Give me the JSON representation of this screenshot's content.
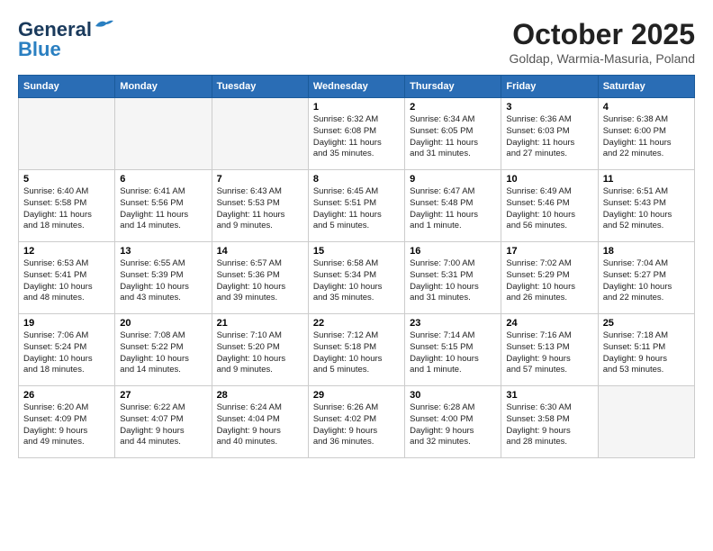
{
  "header": {
    "logo_line1": "General",
    "logo_line2": "Blue",
    "month": "October 2025",
    "location": "Goldap, Warmia-Masuria, Poland"
  },
  "weekdays": [
    "Sunday",
    "Monday",
    "Tuesday",
    "Wednesday",
    "Thursday",
    "Friday",
    "Saturday"
  ],
  "weeks": [
    [
      {
        "day": "",
        "info": ""
      },
      {
        "day": "",
        "info": ""
      },
      {
        "day": "",
        "info": ""
      },
      {
        "day": "1",
        "info": "Sunrise: 6:32 AM\nSunset: 6:08 PM\nDaylight: 11 hours\nand 35 minutes."
      },
      {
        "day": "2",
        "info": "Sunrise: 6:34 AM\nSunset: 6:05 PM\nDaylight: 11 hours\nand 31 minutes."
      },
      {
        "day": "3",
        "info": "Sunrise: 6:36 AM\nSunset: 6:03 PM\nDaylight: 11 hours\nand 27 minutes."
      },
      {
        "day": "4",
        "info": "Sunrise: 6:38 AM\nSunset: 6:00 PM\nDaylight: 11 hours\nand 22 minutes."
      }
    ],
    [
      {
        "day": "5",
        "info": "Sunrise: 6:40 AM\nSunset: 5:58 PM\nDaylight: 11 hours\nand 18 minutes."
      },
      {
        "day": "6",
        "info": "Sunrise: 6:41 AM\nSunset: 5:56 PM\nDaylight: 11 hours\nand 14 minutes."
      },
      {
        "day": "7",
        "info": "Sunrise: 6:43 AM\nSunset: 5:53 PM\nDaylight: 11 hours\nand 9 minutes."
      },
      {
        "day": "8",
        "info": "Sunrise: 6:45 AM\nSunset: 5:51 PM\nDaylight: 11 hours\nand 5 minutes."
      },
      {
        "day": "9",
        "info": "Sunrise: 6:47 AM\nSunset: 5:48 PM\nDaylight: 11 hours\nand 1 minute."
      },
      {
        "day": "10",
        "info": "Sunrise: 6:49 AM\nSunset: 5:46 PM\nDaylight: 10 hours\nand 56 minutes."
      },
      {
        "day": "11",
        "info": "Sunrise: 6:51 AM\nSunset: 5:43 PM\nDaylight: 10 hours\nand 52 minutes."
      }
    ],
    [
      {
        "day": "12",
        "info": "Sunrise: 6:53 AM\nSunset: 5:41 PM\nDaylight: 10 hours\nand 48 minutes."
      },
      {
        "day": "13",
        "info": "Sunrise: 6:55 AM\nSunset: 5:39 PM\nDaylight: 10 hours\nand 43 minutes."
      },
      {
        "day": "14",
        "info": "Sunrise: 6:57 AM\nSunset: 5:36 PM\nDaylight: 10 hours\nand 39 minutes."
      },
      {
        "day": "15",
        "info": "Sunrise: 6:58 AM\nSunset: 5:34 PM\nDaylight: 10 hours\nand 35 minutes."
      },
      {
        "day": "16",
        "info": "Sunrise: 7:00 AM\nSunset: 5:31 PM\nDaylight: 10 hours\nand 31 minutes."
      },
      {
        "day": "17",
        "info": "Sunrise: 7:02 AM\nSunset: 5:29 PM\nDaylight: 10 hours\nand 26 minutes."
      },
      {
        "day": "18",
        "info": "Sunrise: 7:04 AM\nSunset: 5:27 PM\nDaylight: 10 hours\nand 22 minutes."
      }
    ],
    [
      {
        "day": "19",
        "info": "Sunrise: 7:06 AM\nSunset: 5:24 PM\nDaylight: 10 hours\nand 18 minutes."
      },
      {
        "day": "20",
        "info": "Sunrise: 7:08 AM\nSunset: 5:22 PM\nDaylight: 10 hours\nand 14 minutes."
      },
      {
        "day": "21",
        "info": "Sunrise: 7:10 AM\nSunset: 5:20 PM\nDaylight: 10 hours\nand 9 minutes."
      },
      {
        "day": "22",
        "info": "Sunrise: 7:12 AM\nSunset: 5:18 PM\nDaylight: 10 hours\nand 5 minutes."
      },
      {
        "day": "23",
        "info": "Sunrise: 7:14 AM\nSunset: 5:15 PM\nDaylight: 10 hours\nand 1 minute."
      },
      {
        "day": "24",
        "info": "Sunrise: 7:16 AM\nSunset: 5:13 PM\nDaylight: 9 hours\nand 57 minutes."
      },
      {
        "day": "25",
        "info": "Sunrise: 7:18 AM\nSunset: 5:11 PM\nDaylight: 9 hours\nand 53 minutes."
      }
    ],
    [
      {
        "day": "26",
        "info": "Sunrise: 6:20 AM\nSunset: 4:09 PM\nDaylight: 9 hours\nand 49 minutes."
      },
      {
        "day": "27",
        "info": "Sunrise: 6:22 AM\nSunset: 4:07 PM\nDaylight: 9 hours\nand 44 minutes."
      },
      {
        "day": "28",
        "info": "Sunrise: 6:24 AM\nSunset: 4:04 PM\nDaylight: 9 hours\nand 40 minutes."
      },
      {
        "day": "29",
        "info": "Sunrise: 6:26 AM\nSunset: 4:02 PM\nDaylight: 9 hours\nand 36 minutes."
      },
      {
        "day": "30",
        "info": "Sunrise: 6:28 AM\nSunset: 4:00 PM\nDaylight: 9 hours\nand 32 minutes."
      },
      {
        "day": "31",
        "info": "Sunrise: 6:30 AM\nSunset: 3:58 PM\nDaylight: 9 hours\nand 28 minutes."
      },
      {
        "day": "",
        "info": ""
      }
    ]
  ]
}
